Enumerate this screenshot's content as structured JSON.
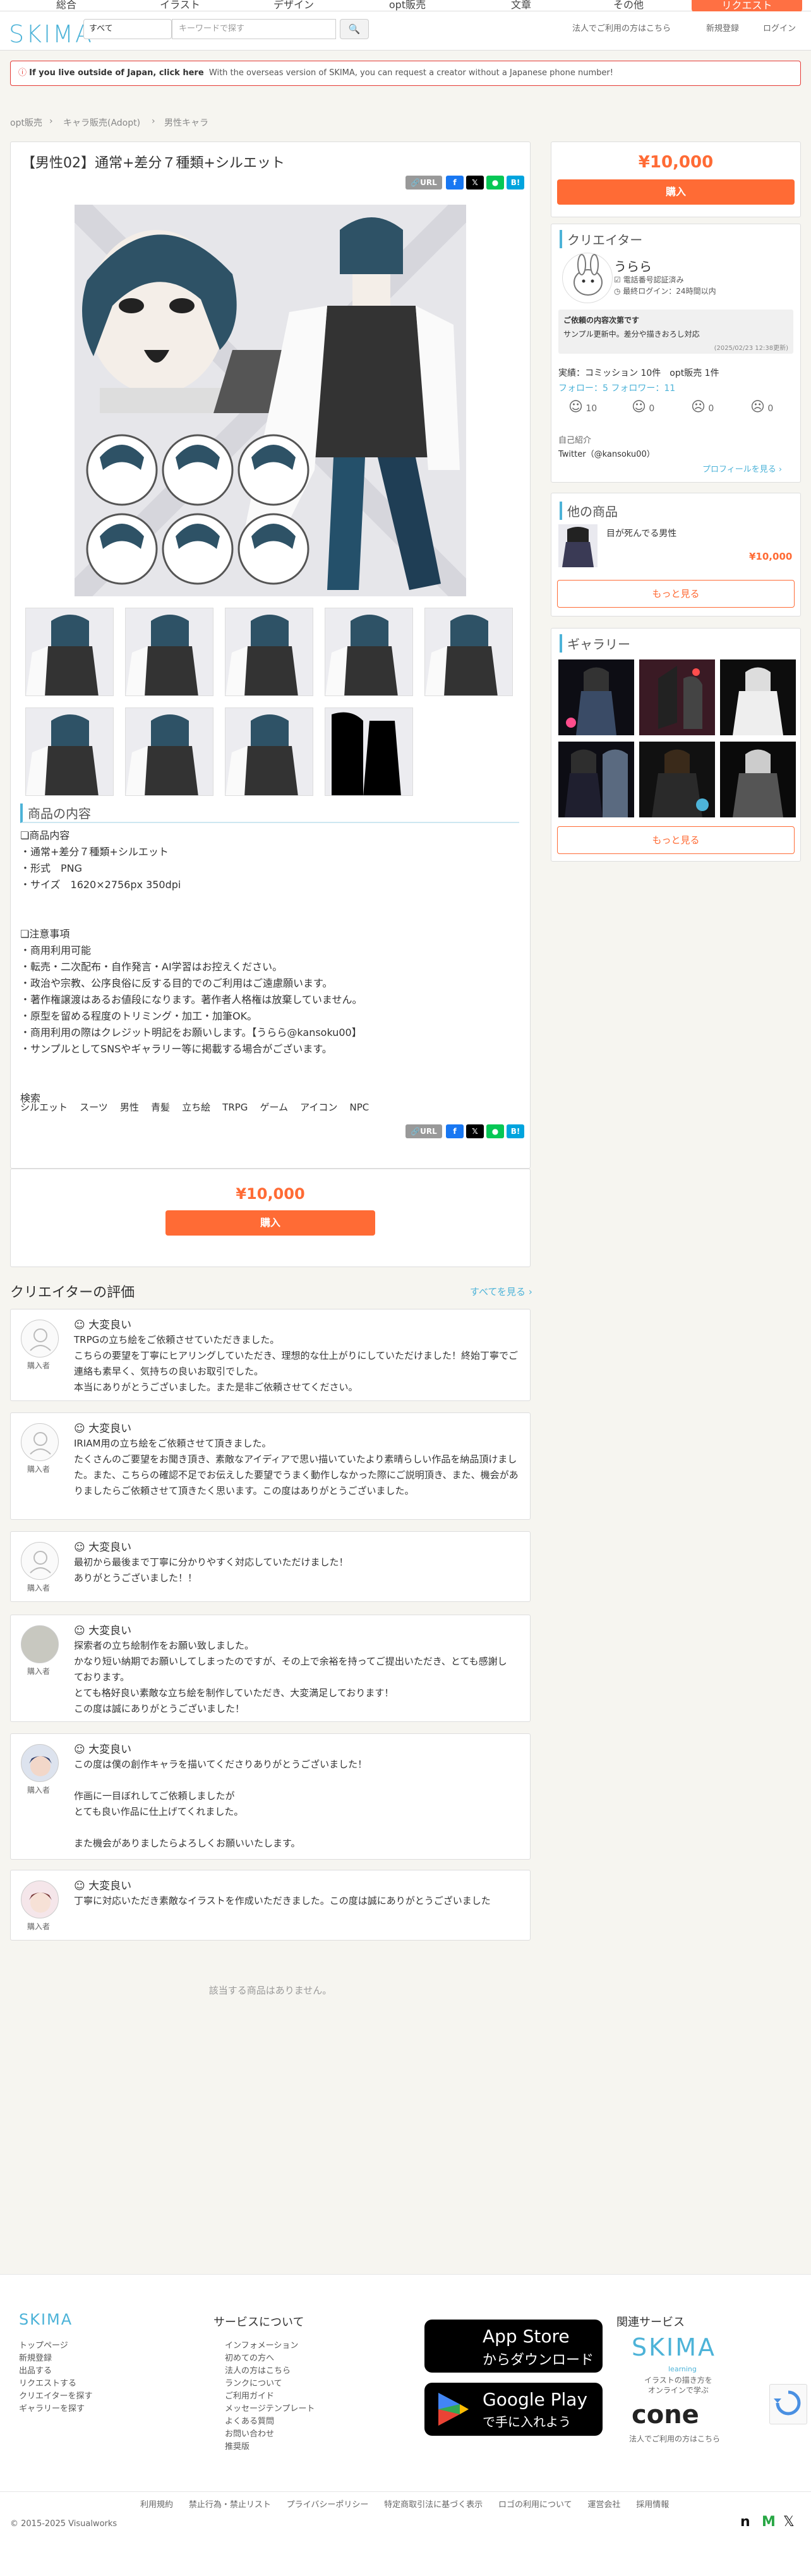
{
  "topnav": {
    "tabs": [
      "総合",
      "イラスト",
      "デザイン",
      "opt販売",
      "文章",
      "その他"
    ],
    "request": "リクエスト"
  },
  "header": {
    "logo": "SKIMA",
    "category": "すべて",
    "search_placeholder": "キーワードで探す",
    "links": [
      "法人でご利用の方はこちら",
      "新規登録",
      "ログイン"
    ]
  },
  "banner": {
    "lead": "If you live outside of Japan, click here",
    "text": "With the overseas version of SKIMA, you can request a creator without a Japanese phone number!"
  },
  "breadcrumb": [
    "opt販売",
    "キャラ販売(Adopt)",
    "男性キャラ"
  ],
  "product": {
    "title": "【男性02】通常+差分７種類+シルエット",
    "share": {
      "url": "URL",
      "hatena": "B!"
    },
    "section_title": "商品の内容",
    "description": "❏商品内容\n・通常+差分７種類+シルエット\n・形式　PNG\n・サイズ　1620×2756px 350dpi\n\n\n❏注意事項\n・商用利用可能\n・転売・二次配布・自作発言・AI学習はお控えください。\n・政治や宗教、公序良俗に反する目的でのご利用はご遠慮願います。\n・著作権譲渡はあるお値段になります。著作者人格権は放棄していません。\n・原型を留める程度のトリミング・加工・加筆OK。\n・商用利用の際はクレジット明記をお願いします。【うらら@kansoku00】\n・サンプルとしてSNSやギャラリー等に掲載する場合がございます。\n\n\n検索",
    "tags": [
      "シルエット",
      "スーツ",
      "男性",
      "青髪",
      "立ち絵",
      "TRPG",
      "ゲーム",
      "アイコン",
      "NPC"
    ],
    "price": "¥10,000",
    "buy": "購入"
  },
  "reviews": {
    "heading": "クリエイターの評価",
    "see_all": "すべてを見る ›",
    "items": [
      {
        "rating": "大変良い",
        "role": "購入者",
        "body": "TRPGの立ち絵をご依頼させていただきました。\nこちらの要望を丁寧にヒアリングしていただき、理想的な仕上がりにしていただけました！終始丁寧でご\n連絡も素早く、気持ちの良いお取引でした。\n本当にありがとうございました。また是非ご依頼させてください。"
      },
      {
        "rating": "大変良い",
        "role": "購入者",
        "body": "IRIAM用の立ち絵をご依頼させて頂きました。\nたくさんのご要望をお聞き頂き、素敵なアイディアで思い描いていたより素晴らしい作品を納品頂けまし\nた。また、こちらの確認不足でお伝えした要望でうまく動作しなかった際にご説明頂き、また、機会があ\nりましたらご依頼させて頂きたく思います。この度はありがとうございました。"
      },
      {
        "rating": "大変良い",
        "role": "購入者",
        "body": "最初から最後まで丁寧に分かりやすく対応していただけました！\nありがとうございました！！"
      },
      {
        "rating": "大変良い",
        "role": "購入者",
        "body": "探索者の立ち絵制作をお願い致しました。\nかなり短い納期でお願いしてしまったのですが、その上で余裕を持ってご提出いただき、とても感謝し\nております。\nとても格好良い素敵な立ち絵を制作していただき、大変満足しております！\nこの度は誠にありがとうございました！"
      },
      {
        "rating": "大変良い",
        "role": "購入者",
        "body": "この度は僕の創作キャラを描いてくださりありがとうございました！\n\n作画に一目ぼれしてご依頼しましたが\nとても良い作品に仕上げてくれました。\n\nまた機会がありましたらよろしくお願いいたします。"
      },
      {
        "rating": "大変良い",
        "role": "購入者",
        "body": "丁寧に対応いただき素敵なイラストを作成いただきました。この度は誠にありがとうございました"
      }
    ],
    "empty": "該当する商品はありません。"
  },
  "sidebar": {
    "price": "¥10,000",
    "buy": "購入",
    "creator_title": "クリエイター",
    "creator_name": "うらら",
    "verified": "電話番号認証済み",
    "last_login": "最終ログイン：24時間以内",
    "notice_title": "ご依頼の内容次第です",
    "notice_body": "サンプル更新中。差分や描きおろし対応",
    "notice_date": "(2025/02/23 12:38更新)",
    "stats": "実績：コミッション 10件　opt販売 1件",
    "follow": "フォロー：5 フォロワー：11",
    "ratings": [
      "10",
      "0",
      "0",
      "0"
    ],
    "intro_label": "自己紹介",
    "twitter": "Twitter（@kansoku00）",
    "profile_link": "プロフィールを見る ›",
    "other_title": "他の商品",
    "other_item": "目が死んでる男性",
    "other_price": "¥10,000",
    "more": "もっと見る",
    "gallery_title": "ギャラリー",
    "gallery_more": "もっと見る"
  },
  "footer": {
    "col1": [
      "トップページ",
      "新規登録",
      "出品する",
      "リクエストする",
      "クリエイターを探す",
      "ギャラリーを探す"
    ],
    "service_title": "サービスについて",
    "col2": [
      "インフォメーション",
      "初めての方へ",
      "法人の方はこちら",
      "ランクについて",
      "ご利用ガイド",
      "メッセージテンプレート",
      "よくある質問",
      "お問い合わせ",
      "推奨版"
    ],
    "appstore_small": "App Store",
    "appstore_big": "からダウンロード",
    "gplay_small": "Google Play",
    "gplay_big": "で手に入れよう",
    "related": "関連サービス",
    "learning": "learning",
    "learning_sub": "イラストの描き方を\nオンラインで学ぶ",
    "cone": "cone",
    "cone_sub": "法人でご利用の方はこちら",
    "bottom_links": [
      "利用規約",
      "禁止行為・禁止リスト",
      "プライバシーポリシー",
      "特定商取引法に基づく表示",
      "ロゴの利用について",
      "運営会社",
      "採用情報"
    ],
    "copyright": "© 2015-2025 Visualworks"
  }
}
